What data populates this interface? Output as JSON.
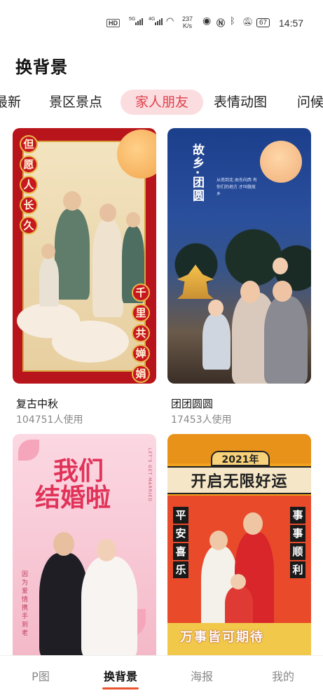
{
  "status_bar": {
    "hd": "HD",
    "signal1": "5G",
    "signal2": "4G",
    "speed_value": "237",
    "speed_unit": "K/s",
    "battery": "67",
    "time": "14:57"
  },
  "header": {
    "title": "换背景"
  },
  "tabs": [
    {
      "label": "最新"
    },
    {
      "label": "景区景点"
    },
    {
      "label": "家人朋友",
      "selected": true
    },
    {
      "label": "表情动图"
    },
    {
      "label": "问候"
    }
  ],
  "cards": [
    {
      "name": "复古中秋",
      "uses": "104751人使用",
      "art_left": [
        "但",
        "愿",
        "人",
        "长",
        "久"
      ],
      "art_right": [
        "千",
        "里",
        "共",
        "婵",
        "娟"
      ]
    },
    {
      "name": "团团圆圆",
      "uses": "17453人使用",
      "art_title": "故乡·团圆",
      "art_lines": "从南到北 由东向西 有你们的地方 才叫做故乡"
    },
    {
      "art_line1": "我们",
      "art_line2": "结婚啦",
      "art_side": "LET'S GET MARRIED",
      "art_vertical": "因为爱情携手到老"
    },
    {
      "art_year": "2021年",
      "art_main": "开启无限好运",
      "art_left": [
        "平",
        "安",
        "喜",
        "乐"
      ],
      "art_right": [
        "事",
        "事",
        "顺",
        "利"
      ],
      "art_bottom": "万事皆可期待"
    }
  ],
  "bottom_nav": [
    {
      "label": "P图"
    },
    {
      "label": "换背景",
      "active": true
    },
    {
      "label": "海报"
    },
    {
      "label": "我的"
    }
  ],
  "colors": {
    "accent": "#e8552e",
    "tab_selected_bg": "#fbdde0",
    "tab_selected_text": "#e0404a"
  }
}
